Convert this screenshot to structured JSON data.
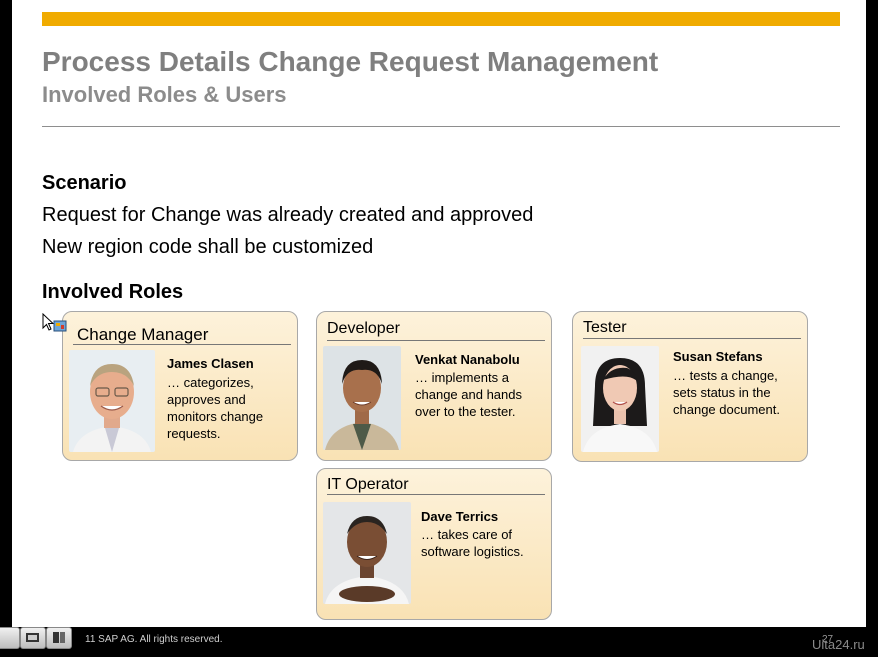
{
  "slide": {
    "title": "Process Details Change Request Management",
    "subtitle": "Involved Roles & Users",
    "scenario_heading": "Scenario",
    "scenario_lines": [
      "Request for Change was already created and approved",
      "New region code shall be customized"
    ],
    "roles_heading": "Involved Roles",
    "accent_color": "#f0ab00"
  },
  "roles": [
    {
      "title": "Change Manager",
      "name": "James Clasen",
      "desc": "… categorizes, approves and monitors change requests."
    },
    {
      "title": "Developer",
      "name": "Venkat Nanabolu",
      "desc": "… implements a change and hands over to the tester."
    },
    {
      "title": "Tester",
      "name": "Susan Stefans",
      "desc": "… tests a change, sets status in the change document."
    },
    {
      "title": "IT Operator",
      "name": "Dave Terrics",
      "desc": "… takes care of software logistics."
    }
  ],
  "footer": {
    "copyright": "11 SAP AG. All rights reserved.",
    "page_number": "27",
    "watermark": "Uіta24.ru"
  }
}
